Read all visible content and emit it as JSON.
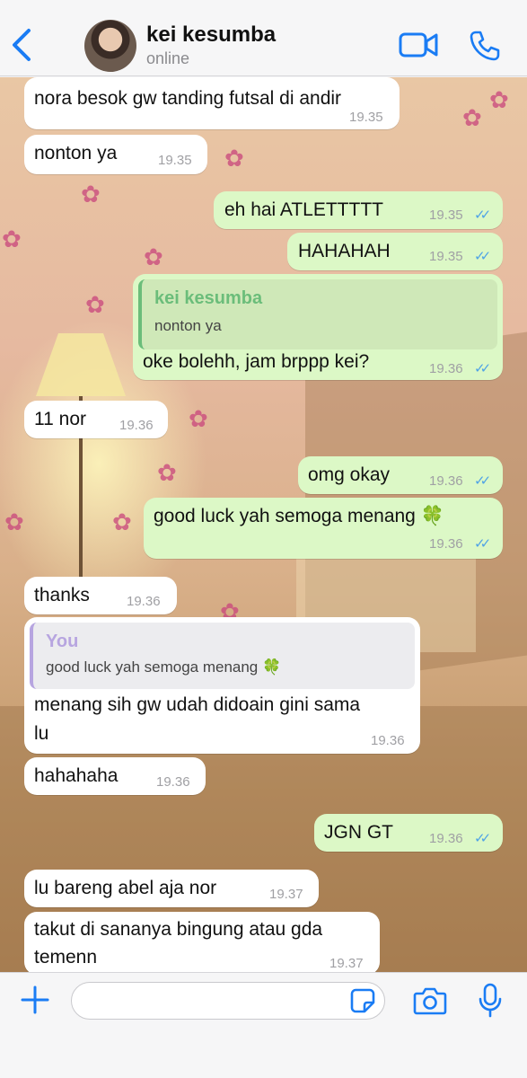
{
  "header": {
    "contact_name": "kei kesumba",
    "status": "online",
    "icons": [
      "back-chevron-icon",
      "avatar",
      "video-camera-icon",
      "phone-icon"
    ]
  },
  "messages": [
    {
      "side": "in",
      "text": "nora besok gw tanding futsal di andir",
      "time": "19.35"
    },
    {
      "side": "in",
      "text": "nonton ya",
      "time": "19.35"
    },
    {
      "side": "out",
      "text": "eh hai ATLETTTTT",
      "time": "19.35",
      "read": true
    },
    {
      "side": "out",
      "text": "HAHAHAH",
      "time": "19.35",
      "read": true
    },
    {
      "side": "out",
      "quote_name": "kei kesumba",
      "quote_text": "nonton ya",
      "text": "oke bolehh, jam brppp kei?",
      "time": "19.36",
      "read": true
    },
    {
      "side": "in",
      "text": "11 nor",
      "time": "19.36"
    },
    {
      "side": "out",
      "text": "omg okay",
      "time": "19.36",
      "read": true
    },
    {
      "side": "out",
      "text": "good luck yah semoga menang 🍀",
      "time": "19.36",
      "read": true
    },
    {
      "side": "in",
      "text": "thanks",
      "time": "19.36"
    },
    {
      "side": "in",
      "quote_name": "You",
      "quote_text": "good luck yah semoga menang 🍀",
      "text_line1": "menang sih gw udah didoain gini sama",
      "text_line2": "lu",
      "time": "19.36"
    },
    {
      "side": "in",
      "text": "hahahaha",
      "time": "19.36"
    },
    {
      "side": "out",
      "text": "JGN GT",
      "time": "19.36",
      "read": true
    },
    {
      "side": "in",
      "text": "lu bareng abel aja nor",
      "time": "19.37"
    },
    {
      "side": "in",
      "text_line1": "takut di sananya bingung atau gda",
      "text_line2": "temenn",
      "time": "19.37"
    }
  ],
  "input": {
    "value": "",
    "icons": [
      "plus-icon",
      "sticker-icon",
      "camera-icon",
      "microphone-icon"
    ]
  },
  "colors": {
    "accent": "#1a7cf4",
    "incoming_bubble": "#ffffff",
    "outgoing_bubble": "#dcf8c6",
    "read_ticks": "#4fa3e6",
    "quote_name_contact": "#6bbd7a",
    "quote_name_you": "#b7a5e0"
  }
}
